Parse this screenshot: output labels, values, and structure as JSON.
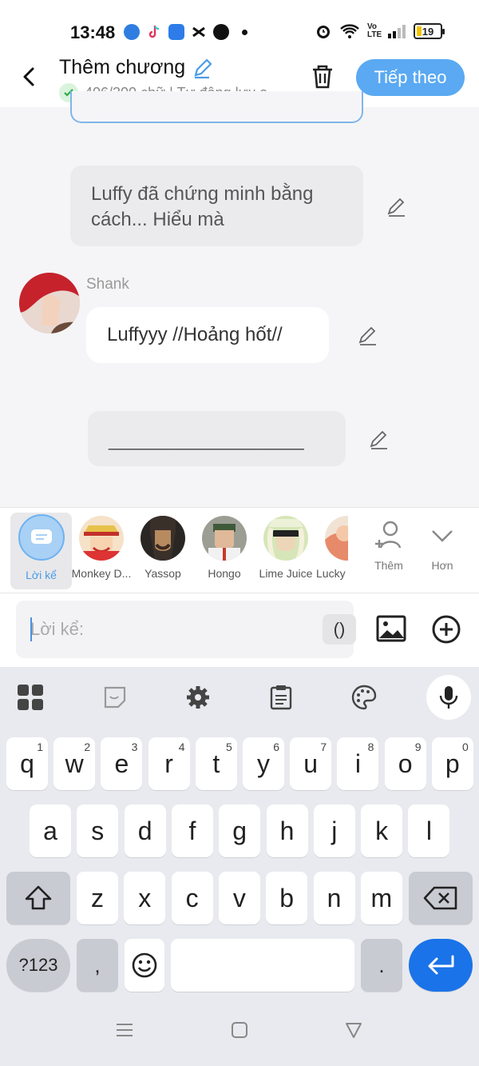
{
  "status_bar": {
    "time": "13:48",
    "battery": "19",
    "lte": "Vo LTE"
  },
  "header": {
    "title": "Thêm chương",
    "subtitle": "406/300 chữ | Tự động lưu s",
    "next_label": "Tiếp theo"
  },
  "chat": {
    "narration": "Luffy đã chứng minh bằng cách... Hiểu mà",
    "speaker": "Shank",
    "message": "Luffyyy //Hoảng hốt//",
    "draft": "____________________"
  },
  "characters": [
    {
      "label": "Lời kể"
    },
    {
      "label": "Monkey D..."
    },
    {
      "label": "Yassop"
    },
    {
      "label": "Hongo"
    },
    {
      "label": "Lime Juice"
    },
    {
      "label": "Lucky"
    }
  ],
  "char_actions": {
    "add_label": "Thêm",
    "more_label": "Hơn"
  },
  "input": {
    "placeholder": "Lời kể:",
    "paren_label": "()"
  },
  "keyboard": {
    "row1": [
      {
        "k": "q",
        "s": "1"
      },
      {
        "k": "w",
        "s": "2"
      },
      {
        "k": "e",
        "s": "3"
      },
      {
        "k": "r",
        "s": "4"
      },
      {
        "k": "t",
        "s": "5"
      },
      {
        "k": "y",
        "s": "6"
      },
      {
        "k": "u",
        "s": "7"
      },
      {
        "k": "i",
        "s": "8"
      },
      {
        "k": "o",
        "s": "9"
      },
      {
        "k": "p",
        "s": "0"
      }
    ],
    "row2": [
      "a",
      "s",
      "d",
      "f",
      "g",
      "h",
      "j",
      "k",
      "l"
    ],
    "row3": [
      "z",
      "x",
      "c",
      "v",
      "b",
      "n",
      "m"
    ],
    "sym_label": "?123",
    "comma": ",",
    "period": "."
  }
}
